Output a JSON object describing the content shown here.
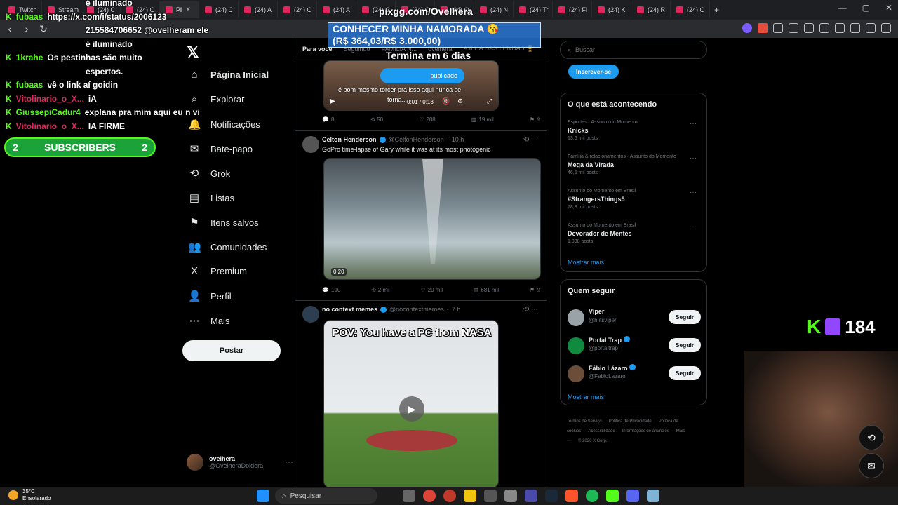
{
  "browser": {
    "tabs": [
      "Twitch",
      "Stream",
      "(24) C",
      "(24) C",
      "Pi",
      "(24) C",
      "(24) A",
      "(24) C",
      "(24) A",
      "(24) C",
      "(24) O",
      "(24) O",
      "(24) N",
      "(24) Tr",
      "(24) Fl",
      "(24) K",
      "(24) R",
      "(24) C"
    ],
    "active_tab_index": 4,
    "new_tab_symbol": "+"
  },
  "overlay": {
    "promo_url": "pixgg.com/Ovelhera",
    "promo_line1": "CONHECER MINHA NAMORADA 😘",
    "promo_line2": "(R$ 364,03/R$ 3.000,00)",
    "timer": "Termina em 6 dias",
    "viewer_count": "184",
    "subscribers_banner": {
      "left": "2",
      "label": "SUBSCRIBERS",
      "right": "2"
    },
    "chat": [
      {
        "user": "",
        "msg": "é iluminado",
        "color": "#ffffff"
      },
      {
        "user": "fubaas",
        "msg": "https://x.com/i/status/2006123",
        "color": "#53fc18"
      },
      {
        "user": "",
        "msg": "215584706652 @ovelheram ele",
        "color": "#ffffff"
      },
      {
        "user": "",
        "msg": "é iluminado",
        "color": "#ffffff"
      },
      {
        "user": "1krahe",
        "msg": "Os pestinhas são muito",
        "color": "#53fc18"
      },
      {
        "user": "",
        "msg": "espertos.",
        "color": "#ffffff"
      },
      {
        "user": "fubaas",
        "msg": "vê o link aí goidin",
        "color": "#53fc18"
      },
      {
        "user": "Vitolinario_o_X...",
        "msg": "iA",
        "color": "#e0245e"
      },
      {
        "user": "GiussepiCadur4",
        "msg": "explana pra mim aqui eu n vi",
        "color": "#53fc18"
      },
      {
        "user": "Vitolinario_o_X...",
        "msg": "IA FIRME",
        "color": "#e0245e"
      }
    ]
  },
  "sidebar": {
    "items": [
      {
        "label": "Página Inicial",
        "icon": "home-icon",
        "glyph": "⌂"
      },
      {
        "label": "Explorar",
        "icon": "search-icon",
        "glyph": "⌕"
      },
      {
        "label": "Notificações",
        "icon": "bell-icon",
        "glyph": "🔔"
      },
      {
        "label": "Bate-papo",
        "icon": "mail-icon",
        "glyph": "✉"
      },
      {
        "label": "Grok",
        "icon": "grok-icon",
        "glyph": "⟲"
      },
      {
        "label": "Listas",
        "icon": "list-icon",
        "glyph": "▤"
      },
      {
        "label": "Itens salvos",
        "icon": "bookmark-icon",
        "glyph": "⚑"
      },
      {
        "label": "Comunidades",
        "icon": "people-icon",
        "glyph": "👥"
      },
      {
        "label": "Premium",
        "icon": "x-icon",
        "glyph": "X"
      },
      {
        "label": "Perfil",
        "icon": "person-icon",
        "glyph": "👤"
      },
      {
        "label": "Mais",
        "icon": "more-icon",
        "glyph": "⋯"
      }
    ],
    "post_button": "Postar",
    "profile": {
      "name": "ovelhera",
      "handle": "@OvelheraDoidera"
    }
  },
  "feed": {
    "tabs": [
      "Para você",
      "Seguindo",
      "FAMILIA N...",
      "ovelhera",
      "A ILHA DAS LENDAS 🏆"
    ],
    "tweet1": {
      "caption": "é bom mesmo torcer pra isso aqui nunca se",
      "caption2": "torna...",
      "badge": "publicado",
      "time": "0:01 / 0:13",
      "replies": "8",
      "reposts": "50",
      "likes": "288",
      "views": "19 mil"
    },
    "tweet2": {
      "name": "Celton Henderson",
      "handle": "@CeltonHenderson",
      "age": "10 h",
      "text": "GoPro time-lapse of Gary while it was at its most photogenic",
      "duration": "0:20",
      "replies": "190",
      "reposts": "2 mil",
      "likes": "20 mil",
      "views": "681 mil"
    },
    "tweet3": {
      "name": "no context memes",
      "handle": "@nocontextmemes",
      "age": "7 h",
      "media_text": "POV: You have a PC from NASA"
    }
  },
  "right": {
    "search_placeholder": "Buscar",
    "subscribe": "Inscrever-se",
    "trends_title": "O que está acontecendo",
    "trends": [
      {
        "context": "Esportes · Assunto do Momento",
        "name": "Knicks",
        "count": "13,6 mil posts"
      },
      {
        "context": "Família & relacionamentos · Assunto do Momento",
        "name": "Mega da Virada",
        "count": "46,5 mil posts"
      },
      {
        "context": "Assunto do Momento em Brasil",
        "name": "#StrangersThings5",
        "count": "78,8 mil posts"
      },
      {
        "context": "Assunto do Momento em Brasil",
        "name": "Devorador de Mentes",
        "count": "1.988 posts"
      }
    ],
    "show_more": "Mostrar mais",
    "who_title": "Quem seguir",
    "who": [
      {
        "name": "Viper",
        "handle": "@hiitsviper",
        "verified": false
      },
      {
        "name": "Portal Trap",
        "handle": "@portaltrap",
        "verified": true
      },
      {
        "name": "Fábio Lázaro",
        "handle": "@FabioLazaro_",
        "verified": true
      }
    ],
    "follow_label": "Seguir",
    "footer": [
      "Termos de Serviço",
      "Política de Privacidade",
      "Política de cookies",
      "Acessibilidade",
      "Informações de anúncios",
      "Mais ···",
      "© 2026 X Corp."
    ]
  },
  "taskbar": {
    "temp": "35°C",
    "weather": "Ensolarado",
    "search": "Pesquisar"
  }
}
